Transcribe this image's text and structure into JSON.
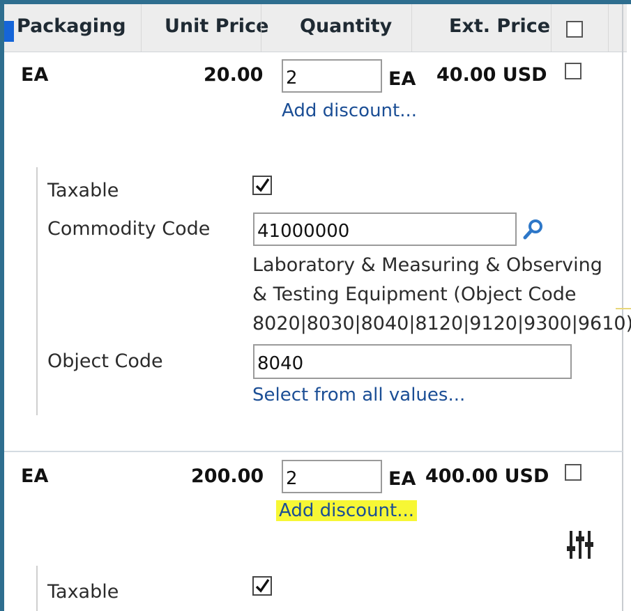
{
  "header": {
    "packaging": "Packaging",
    "unit_price": "Unit Price",
    "quantity": "Quantity",
    "ext_price": "Ext. Price"
  },
  "lines": [
    {
      "uom": "EA",
      "unit_price": "20.00",
      "quantity": "2",
      "qty_uom": "EA",
      "ext_price": "40.00 USD",
      "add_discount": "Add discount..."
    },
    {
      "uom": "EA",
      "unit_price": "200.00",
      "quantity": "2",
      "qty_uom": "EA",
      "ext_price": "400.00 USD",
      "add_discount": "Add discount..."
    }
  ],
  "details": {
    "taxable_label": "Taxable",
    "commodity_label": "Commodity Code",
    "commodity_value": "41000000",
    "commodity_desc_1": "Laboratory & Measuring & Observing",
    "commodity_desc_2": "& Testing Equipment (Object Code",
    "commodity_desc_3": "8020|8030|8040|8120|9120|9300|9610)",
    "object_code_label": "Object Code",
    "object_code_value": "8040",
    "select_all": "Select from all values...",
    "taxable_label_2": "Taxable"
  },
  "icons": {
    "search": "magnifier-icon",
    "settings": "sliders-icon"
  },
  "colors": {
    "frame": "#2e6e8f",
    "link": "#1b4e95",
    "highlight": "#f7f735"
  }
}
